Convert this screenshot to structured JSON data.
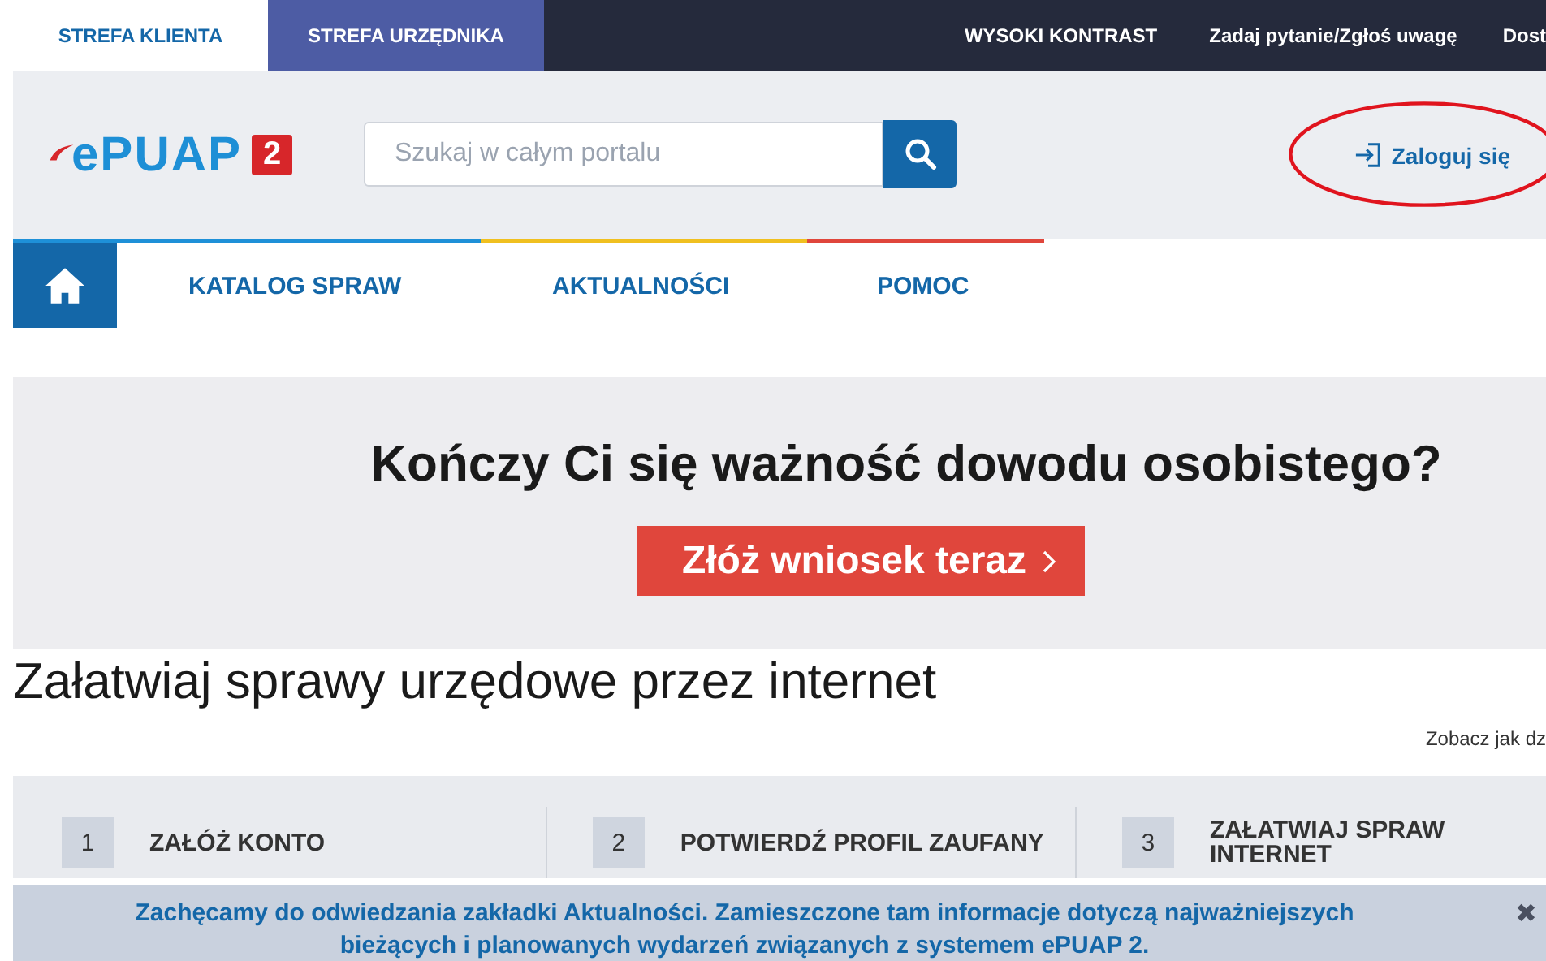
{
  "top_bar": {
    "zones": [
      {
        "label": "STREFA KLIENTA",
        "selected": true
      },
      {
        "label": "STREFA URZĘDNIKA",
        "selected": false
      }
    ],
    "links": [
      "WYSOKI KONTRAST",
      "Zadaj pytanie/Zgłoś uwagę",
      "Dost"
    ]
  },
  "header": {
    "logo": "ePUAP",
    "logo_badge": "2",
    "search": {
      "placeholder": "Szukaj w całym portalu"
    },
    "login": "Zaloguj się"
  },
  "nav": {
    "items": [
      {
        "label": "KATALOG SPRAW",
        "color": "#1e90d8"
      },
      {
        "label": "AKTUALNOŚCI",
        "color": "#f0c020"
      },
      {
        "label": "POMOC",
        "color": "#e0463c"
      }
    ]
  },
  "banner": {
    "title": "Kończy Ci się ważność dowodu osobistego?",
    "button": "Złóż wniosek teraz"
  },
  "heading": "Załatwiaj sprawy urzędowe przez internet",
  "see_how": "Zobacz jak dz",
  "steps": [
    {
      "number": "1",
      "label": "ZAŁÓŻ KONTO"
    },
    {
      "number": "2",
      "label": "POTWIERDŹ PROFIL ZAUFANY"
    },
    {
      "number": "3",
      "label": "ZAŁATWIAJ SPRAW INTERNET"
    }
  ],
  "notice": {
    "text": "Zachęcamy do odwiedzania zakładki Aktualności. Zamieszczone tam informacje dotyczą najważniejszych bieżących i planowanych wydarzeń związanych z systemem ePUAP 2.",
    "close": "✖"
  }
}
